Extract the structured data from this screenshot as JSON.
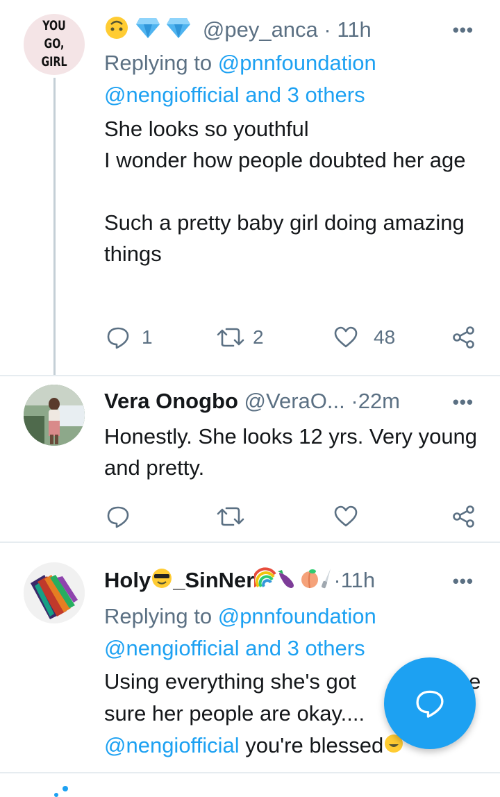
{
  "tweets": [
    {
      "emojis": [
        "upside-down-face",
        "gem",
        "gem"
      ],
      "handle": "@pey_anca",
      "dot": "·",
      "time": "11h",
      "more": "•••",
      "replying_label": "Replying to ",
      "replying_mention": "@pnnfoundation",
      "replying_line2_mention": "@nengiofficial",
      "replying_line2_rest": " and 3 others",
      "text": "She looks so youthful\nI wonder how people doubted her age\n\nSuch a pretty baby girl doing amazing things",
      "avatar_text": [
        "YOU",
        "GO,",
        "GIRL"
      ],
      "reply_count": "1",
      "retweet_count": "2",
      "like_count": "48"
    },
    {
      "name": "Vera Onogbo",
      "handle": "@VeraO...",
      "dot": "·",
      "time": "22m",
      "more": "•••",
      "text": "Honestly. She looks 12 yrs. Very young and pretty."
    },
    {
      "name_part1": "Holy",
      "name_part2": "_SinNer",
      "name_emojis": [
        "smiling-face-with-sunglasses",
        "rainbow",
        "eggplant",
        "peach",
        "knife"
      ],
      "dot": "·",
      "time": "11h",
      "more": "•••",
      "replying_label": "Replying to ",
      "replying_mention": "@pnnfoundation",
      "replying_line2_mention": "@nengiofficial",
      "replying_line2_rest": " and 3 others",
      "text_line1": "Using everything she's got",
      "text_line1_tail": "e",
      "text_line2": "sure her people are okay....",
      "text_line3_mention": "@nengiofficial",
      "text_line3_rest": " you're blessed"
    }
  ],
  "colors": {
    "accent": "#1da1f2",
    "secondary_text": "#5b7083",
    "divider": "#e6ecf0"
  },
  "fab": {
    "icon": "compose-reply-icon"
  }
}
